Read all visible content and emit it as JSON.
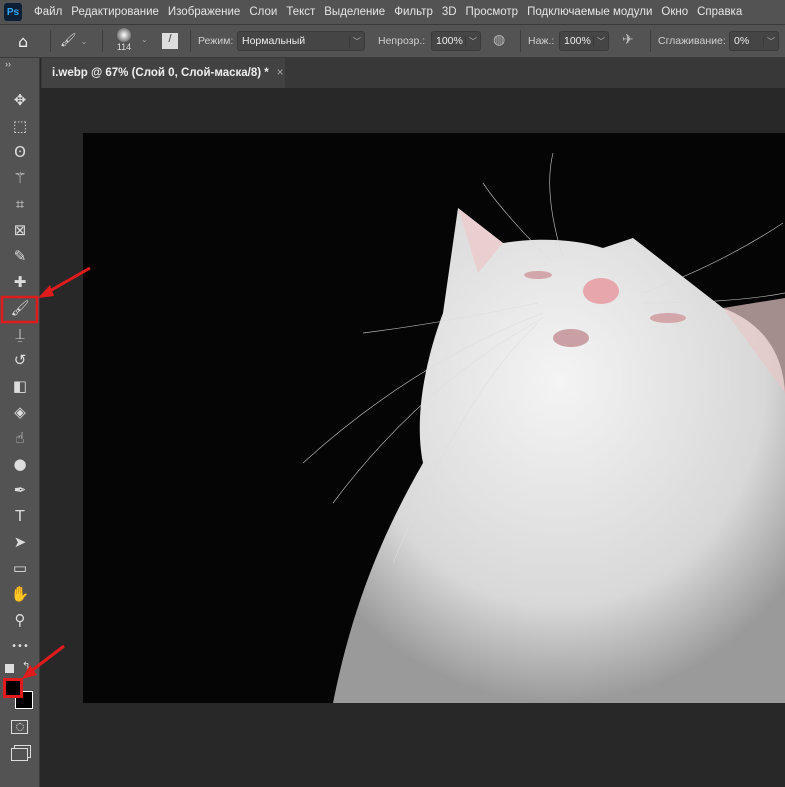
{
  "app": {
    "logo": "Ps"
  },
  "menu": [
    "Файл",
    "Редактирование",
    "Изображение",
    "Слои",
    "Текст",
    "Выделение",
    "Фильтр",
    "3D",
    "Просмотр",
    "Подключаемые модули",
    "Окно",
    "Справка"
  ],
  "options": {
    "brush_size": "114",
    "mode_label": "Режим:",
    "mode_value": "Нормальный",
    "opacity_label": "Непрозр.:",
    "opacity_value": "100%",
    "pressure_label": "Наж.:",
    "pressure_value": "100%",
    "smoothing_label": "Сглаживание:",
    "smoothing_value": "0%"
  },
  "tab": {
    "title": "i.webp @ 67% (Слой 0, Слой-маска/8) *",
    "close": "×"
  },
  "tools": [
    {
      "name": "move",
      "glyph": "✥"
    },
    {
      "name": "marquee",
      "glyph": "⬚"
    },
    {
      "name": "lasso",
      "glyph": "ʘ"
    },
    {
      "name": "magic-wand",
      "glyph": "⚚"
    },
    {
      "name": "crop",
      "glyph": "⌗"
    },
    {
      "name": "frame",
      "glyph": "⊠"
    },
    {
      "name": "eyedropper",
      "glyph": "✎"
    },
    {
      "name": "healing",
      "glyph": "✚"
    },
    {
      "name": "brush",
      "glyph": "🖌"
    },
    {
      "name": "stamp",
      "glyph": "⍊"
    },
    {
      "name": "history-brush",
      "glyph": "↺"
    },
    {
      "name": "eraser",
      "glyph": "◧"
    },
    {
      "name": "paint-bucket",
      "glyph": "◈"
    },
    {
      "name": "smudge",
      "glyph": "☝"
    },
    {
      "name": "dodge",
      "glyph": "●"
    },
    {
      "name": "pen",
      "glyph": "✒"
    },
    {
      "name": "type",
      "glyph": "T"
    },
    {
      "name": "path-select",
      "glyph": "➤"
    },
    {
      "name": "rectangle",
      "glyph": "▭"
    },
    {
      "name": "hand",
      "glyph": "✋"
    },
    {
      "name": "zoom",
      "glyph": "⚲"
    },
    {
      "name": "more",
      "glyph": "•••"
    }
  ],
  "colors": {
    "foreground": "#000000",
    "background": "#000000",
    "highlight": "#e01b1b"
  },
  "active_tool": "brush"
}
